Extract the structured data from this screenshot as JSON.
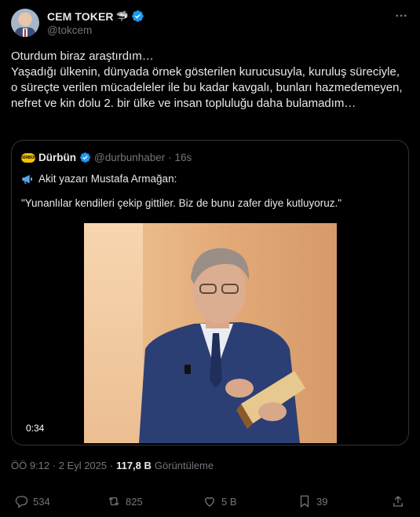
{
  "author": {
    "name": "CEM TOKER",
    "handle": "@tokcem",
    "badge_emoji": "🦈"
  },
  "tweet": {
    "text": "Oturdum biraz araştırdım…\nYaşadığı ülkenin, dünyada örnek gösterilen kurucusuyla, kuruluş süreciyle, o süreçte verilen mücadeleler ile bu kadar kavgalı, bunları hazmedemeyen, nefret ve kin dolu 2. bir ülke ve insan topluluğu daha bulamadım…"
  },
  "quote": {
    "logo_text": "DÜRBÜN",
    "name": "Dürbün",
    "handle": "@durbunhaber",
    "time": "· 16s",
    "line1": "Akit yazarı Mustafa Armağan:",
    "line2": "\"Yunanlılar kendileri çekip gittiler. Biz de bunu zafer diye kutluyoruz.\"",
    "video_duration": "0:34"
  },
  "meta": {
    "timestamp": "ÖÖ 9:12 · 2 Eyl 2025 ·",
    "views": "117,8 B",
    "views_label": "Görüntüleme"
  },
  "actions": {
    "replies": "534",
    "reposts": "825",
    "likes": "5 B",
    "bookmarks": "39"
  },
  "colors": {
    "background": "#000000",
    "text": "#e7e9ea",
    "muted": "#71767b",
    "verified": "#1d9bf0",
    "border": "#2f3336"
  }
}
